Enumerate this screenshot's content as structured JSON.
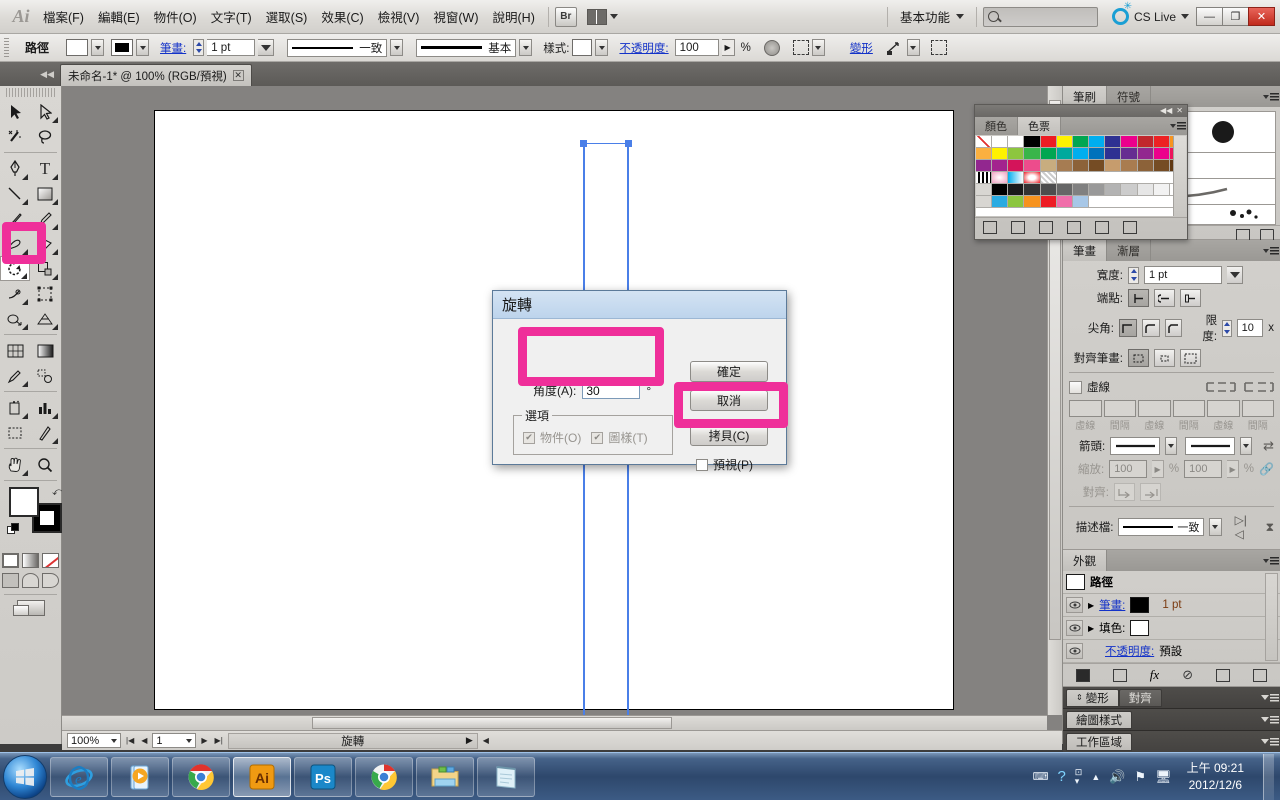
{
  "app": {
    "logo": "Ai",
    "menus": [
      "檔案(F)",
      "編輯(E)",
      "物件(O)",
      "文字(T)",
      "選取(S)",
      "效果(C)",
      "檢視(V)",
      "視窗(W)",
      "說明(H)"
    ],
    "bridge_label": "Br",
    "workspace": "基本功能",
    "search_placeholder": "",
    "cs_live": "CS Live",
    "window_buttons": {
      "minimize": "—",
      "restore": "❐",
      "close": "✕"
    }
  },
  "control_bar": {
    "object_label": "路徑",
    "stroke_label": "筆畫:",
    "stroke_weight": "1 pt",
    "brush_profile": "一致",
    "style_stroke": "基本",
    "style_label": "樣式:",
    "opacity_label": "不透明度:",
    "opacity_value": "100",
    "percent": "%",
    "transform_label": "變形",
    "align_label": ""
  },
  "document_tab": {
    "title": "未命名-1* @ 100% (RGB/預視)",
    "close": "✕"
  },
  "toolbox": {
    "tools": [
      "selection-tool",
      "direct-selection-tool",
      "magic-wand-tool",
      "lasso-tool",
      "pen-tool",
      "type-tool",
      "line-segment-tool",
      "rectangle-tool",
      "paintbrush-tool",
      "pencil-tool",
      "blob-brush-tool",
      "eraser-tool",
      "rotate-tool",
      "scale-tool",
      "width-tool",
      "free-transform-tool",
      "shape-builder-tool",
      "perspective-grid-tool",
      "mesh-tool",
      "gradient-tool",
      "eyedropper-tool",
      "blend-tool",
      "symbol-sprayer-tool",
      "column-graph-tool",
      "artboard-tool",
      "slice-tool",
      "hand-tool",
      "zoom-tool"
    ],
    "selected_tool": "rotate-tool"
  },
  "canvas": {
    "zoom": "100%",
    "page_number": "1",
    "status_text": "旋轉"
  },
  "dialog": {
    "title": "旋轉",
    "angle_label": "角度(A):",
    "angle_value": "30",
    "degree_symbol": "°",
    "options_legend": "選項",
    "option_objects": "物件(O)",
    "option_patterns": "圖樣(T)",
    "option_objects_checked": true,
    "option_patterns_checked": true,
    "buttons": {
      "ok": "確定",
      "cancel": "取消",
      "copy": "拷貝(C)"
    },
    "preview_label": "預視(P)",
    "preview_checked": false,
    "highlight_color": "#ef2f9a"
  },
  "panels": {
    "brushes_symbols": {
      "tabs": [
        "筆刷",
        "符號"
      ],
      "active": "筆刷"
    },
    "swatches_float": {
      "tabs": [
        "顏色",
        "色票"
      ],
      "active": "色票"
    },
    "stroke": {
      "tabs": [
        "筆畫",
        "漸層"
      ],
      "active": "筆畫",
      "width_label": "寬度:",
      "width_value": "1 pt",
      "cap_label": "端點:",
      "corner_label": "尖角:",
      "limit_label": "限度:",
      "limit_value": "10",
      "limit_unit": "x",
      "align_label": "對齊筆畫:",
      "dashed_label": "虛線",
      "dash_labels": [
        "虛線",
        "間隔",
        "虛線",
        "間隔",
        "虛線",
        "間隔"
      ],
      "arrow_label": "箭頭:",
      "scale_label": "縮放:",
      "scale_value_1": "100",
      "scale_value_2": "100",
      "percent": "%",
      "align_arrows_label": "對齊:",
      "profile_label": "描述檔:",
      "profile_value": "一致"
    },
    "appearance": {
      "tab": "外觀",
      "object_type": "路徑",
      "rows": [
        {
          "name": "筆畫:",
          "value": "1 pt",
          "swatch": "black"
        },
        {
          "name": "填色:",
          "value": "",
          "swatch": "white"
        }
      ],
      "opacity_label": "不透明度:",
      "opacity_value": "預設"
    },
    "collapsed": [
      {
        "tabs": [
          "變形",
          "對齊"
        ]
      },
      {
        "tabs": [
          "繪圖樣式"
        ]
      },
      {
        "tabs": [
          "工作區域"
        ]
      }
    ]
  },
  "taskbar": {
    "items": [
      "internet-explorer-icon",
      "windows-media-player-icon",
      "google-chrome-icon",
      "adobe-illustrator-icon",
      "adobe-photoshop-icon",
      "google-chrome-icon",
      "file-explorer-icon",
      "notepad-icon"
    ],
    "active_item": "adobe-illustrator-icon",
    "tray_icons": [
      "keyboard-icon",
      "help-icon",
      "show-hidden-icons-icon",
      "volume-icon",
      "network-flag-icon",
      "action-center-icon"
    ],
    "time": "上午 09:21",
    "date": "2012/12/6"
  }
}
